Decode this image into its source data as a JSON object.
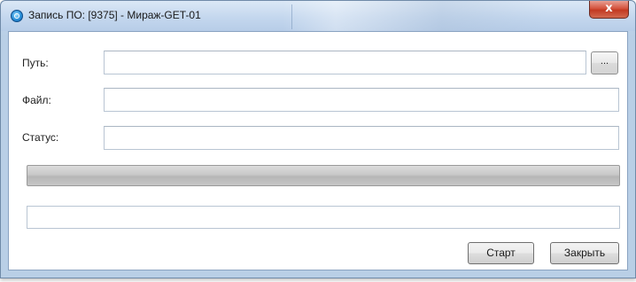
{
  "window": {
    "title": "Запись ПО: [9375] - Мираж-GET-01",
    "close_label": "x"
  },
  "form": {
    "path_label": "Путь:",
    "path_value": "",
    "browse_label": "...",
    "file_label": "Файл:",
    "file_value": "",
    "status_label": "Статус:",
    "status_value": ""
  },
  "progress": {
    "value_percent": 0
  },
  "log": {
    "text": ""
  },
  "buttons": {
    "start_label": "Старт",
    "close_label": "Закрыть"
  },
  "icons": {
    "app": "app-icon",
    "close": "close-icon"
  },
  "colors": {
    "close_button": "#c23a22",
    "titlebar": "#c4d7ee"
  }
}
